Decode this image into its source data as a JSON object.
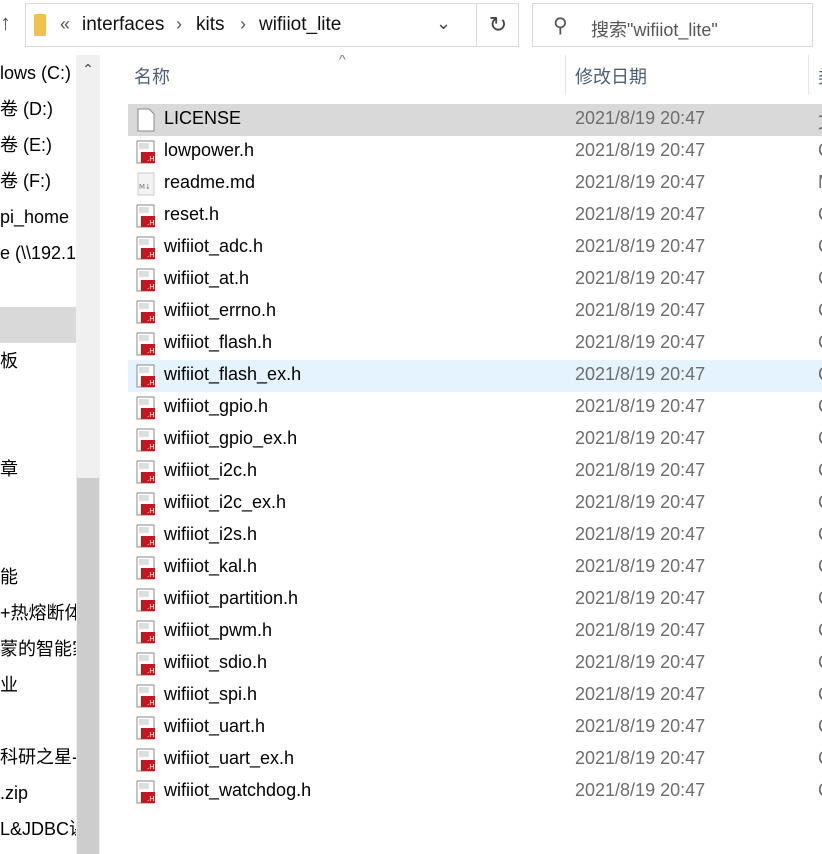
{
  "nav": {
    "up_icon": "arrow-up-icon"
  },
  "address": {
    "overflow": "«",
    "crumbs": [
      "interfaces",
      "kits",
      "wifiiot_lite"
    ],
    "separator": "›",
    "dropdown_icon": "chevron-down-icon",
    "refresh_icon": "refresh-icon"
  },
  "search": {
    "placeholder": "搜索\"wifiiot_lite\"",
    "icon": "search-icon"
  },
  "sidebar": {
    "items": [
      {
        "label": "lows (C:)"
      },
      {
        "label": "卷 (D:)"
      },
      {
        "label": "卷 (E:)"
      },
      {
        "label": "卷 (F:)"
      },
      {
        "label": "pi_home"
      },
      {
        "label": "e (\\\\192.1"
      },
      {
        "label": ""
      },
      {
        "label": "",
        "selected": true
      },
      {
        "label": "板"
      },
      {
        "label": ""
      },
      {
        "label": ""
      },
      {
        "label": "章"
      },
      {
        "label": ""
      },
      {
        "label": ""
      },
      {
        "label": "能"
      },
      {
        "label": "+热熔断体"
      },
      {
        "label": "蒙的智能家"
      },
      {
        "label": "业"
      },
      {
        "label": ""
      },
      {
        "label": "科研之星-"
      },
      {
        "label": ".zip"
      },
      {
        "label": "L&JDBC课"
      }
    ]
  },
  "columns": {
    "name": "名称",
    "date": "修改日期",
    "type": "类"
  },
  "files": [
    {
      "name": "LICENSE",
      "date": "2021/8/19 20:47",
      "type": "文",
      "icon": "file"
    },
    {
      "name": "lowpower.h",
      "date": "2021/8/19 20:47",
      "type": "C",
      "icon": "h"
    },
    {
      "name": "readme.md",
      "date": "2021/8/19 20:47",
      "type": "M",
      "icon": "md"
    },
    {
      "name": "reset.h",
      "date": "2021/8/19 20:47",
      "type": "C",
      "icon": "h"
    },
    {
      "name": "wifiiot_adc.h",
      "date": "2021/8/19 20:47",
      "type": "C",
      "icon": "h"
    },
    {
      "name": "wifiiot_at.h",
      "date": "2021/8/19 20:47",
      "type": "C",
      "icon": "h"
    },
    {
      "name": "wifiiot_errno.h",
      "date": "2021/8/19 20:47",
      "type": "C",
      "icon": "h"
    },
    {
      "name": "wifiiot_flash.h",
      "date": "2021/8/19 20:47",
      "type": "C",
      "icon": "h"
    },
    {
      "name": "wifiiot_flash_ex.h",
      "date": "2021/8/19 20:47",
      "type": "C",
      "icon": "h"
    },
    {
      "name": "wifiiot_gpio.h",
      "date": "2021/8/19 20:47",
      "type": "C",
      "icon": "h"
    },
    {
      "name": "wifiiot_gpio_ex.h",
      "date": "2021/8/19 20:47",
      "type": "C",
      "icon": "h"
    },
    {
      "name": "wifiiot_i2c.h",
      "date": "2021/8/19 20:47",
      "type": "C",
      "icon": "h"
    },
    {
      "name": "wifiiot_i2c_ex.h",
      "date": "2021/8/19 20:47",
      "type": "C",
      "icon": "h"
    },
    {
      "name": "wifiiot_i2s.h",
      "date": "2021/8/19 20:47",
      "type": "C",
      "icon": "h"
    },
    {
      "name": "wifiiot_kal.h",
      "date": "2021/8/19 20:47",
      "type": "C",
      "icon": "h"
    },
    {
      "name": "wifiiot_partition.h",
      "date": "2021/8/19 20:47",
      "type": "C",
      "icon": "h"
    },
    {
      "name": "wifiiot_pwm.h",
      "date": "2021/8/19 20:47",
      "type": "C",
      "icon": "h"
    },
    {
      "name": "wifiiot_sdio.h",
      "date": "2021/8/19 20:47",
      "type": "C",
      "icon": "h"
    },
    {
      "name": "wifiiot_spi.h",
      "date": "2021/8/19 20:47",
      "type": "C",
      "icon": "h"
    },
    {
      "name": "wifiiot_uart.h",
      "date": "2021/8/19 20:47",
      "type": "C",
      "icon": "h"
    },
    {
      "name": "wifiiot_uart_ex.h",
      "date": "2021/8/19 20:47",
      "type": "C",
      "icon": "h"
    },
    {
      "name": "wifiiot_watchdog.h",
      "date": "2021/8/19 20:47",
      "type": "C",
      "icon": "h"
    }
  ],
  "state": {
    "selected_index": 0,
    "hover_index": 8
  },
  "colors": {
    "selected": "#d9d9d9",
    "hover": "#e5f3ff",
    "header_text": "#4c607a",
    "h_icon_red": "#c4161c"
  }
}
